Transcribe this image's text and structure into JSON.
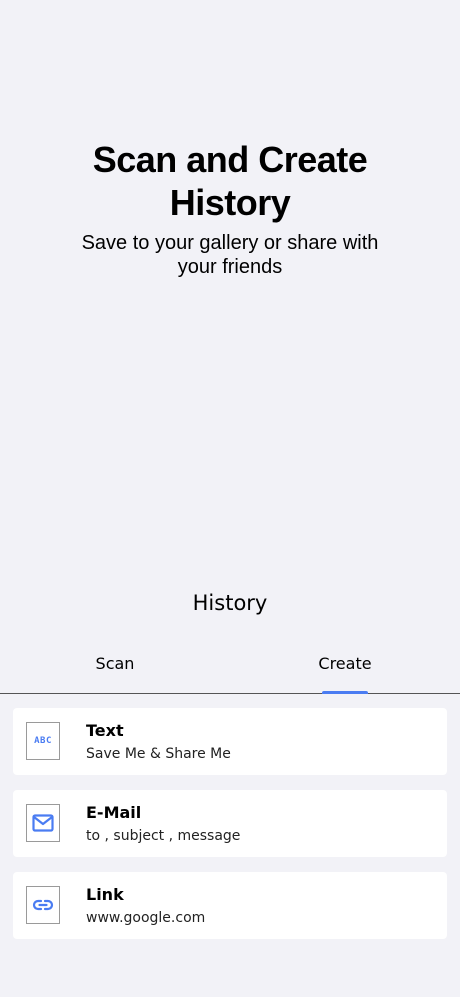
{
  "onboarding": {
    "title": "Scan and Create History",
    "subtitle": "Save to your gallery or share with your friends"
  },
  "screen": {
    "title": "History"
  },
  "tabs": [
    {
      "label": "Scan",
      "selected": false
    },
    {
      "label": "Create",
      "selected": true
    }
  ],
  "colors": {
    "accent": "#4a7cf2",
    "background": "#f2f2f7",
    "card": "#ffffff"
  },
  "items": [
    {
      "icon": "abc-text-icon",
      "icon_text": "ABC",
      "title": "Text",
      "subtitle": "Save Me & Share Me"
    },
    {
      "icon": "mail-icon",
      "title": "E-Mail",
      "subtitle": "to , subject , message"
    },
    {
      "icon": "link-icon",
      "title": "Link",
      "subtitle": "www.google.com"
    }
  ]
}
